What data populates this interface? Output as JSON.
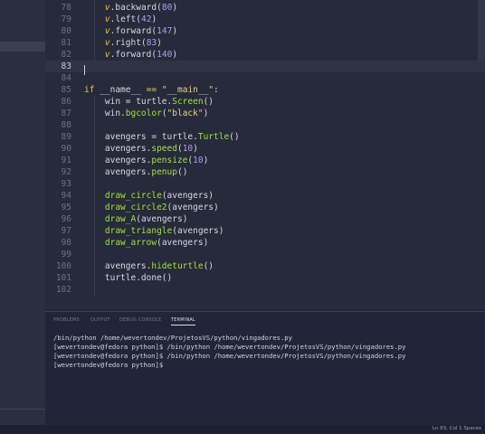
{
  "editor": {
    "lines": [
      {
        "n": "78",
        "segments": [
          {
            "t": "    ",
            "c": ""
          },
          {
            "t": "v",
            "c": "it"
          },
          {
            "t": ".",
            "c": ""
          },
          {
            "t": "backward",
            "c": ""
          },
          {
            "t": "(",
            "c": ""
          },
          {
            "t": "80",
            "c": "nu"
          },
          {
            "t": ")",
            "c": ""
          }
        ]
      },
      {
        "n": "79",
        "segments": [
          {
            "t": "    ",
            "c": ""
          },
          {
            "t": "v",
            "c": "it"
          },
          {
            "t": ".",
            "c": ""
          },
          {
            "t": "left",
            "c": ""
          },
          {
            "t": "(",
            "c": ""
          },
          {
            "t": "42",
            "c": "nu"
          },
          {
            "t": ")",
            "c": ""
          }
        ]
      },
      {
        "n": "80",
        "segments": [
          {
            "t": "    ",
            "c": ""
          },
          {
            "t": "v",
            "c": "it"
          },
          {
            "t": ".",
            "c": ""
          },
          {
            "t": "forward",
            "c": ""
          },
          {
            "t": "(",
            "c": ""
          },
          {
            "t": "147",
            "c": "nu"
          },
          {
            "t": ")",
            "c": ""
          }
        ]
      },
      {
        "n": "81",
        "segments": [
          {
            "t": "    ",
            "c": ""
          },
          {
            "t": "v",
            "c": "it"
          },
          {
            "t": ".",
            "c": ""
          },
          {
            "t": "right",
            "c": ""
          },
          {
            "t": "(",
            "c": ""
          },
          {
            "t": "83",
            "c": "nu"
          },
          {
            "t": ")",
            "c": ""
          }
        ]
      },
      {
        "n": "82",
        "segments": [
          {
            "t": "    ",
            "c": ""
          },
          {
            "t": "v",
            "c": "it"
          },
          {
            "t": ".",
            "c": ""
          },
          {
            "t": "forward",
            "c": ""
          },
          {
            "t": "(",
            "c": ""
          },
          {
            "t": "140",
            "c": "nu"
          },
          {
            "t": ")",
            "c": ""
          }
        ]
      },
      {
        "n": "83",
        "segments": [],
        "current": true
      },
      {
        "n": "84",
        "segments": []
      },
      {
        "n": "85",
        "segments": [
          {
            "t": "if",
            "c": "kw"
          },
          {
            "t": " __name__ ",
            "c": ""
          },
          {
            "t": "==",
            "c": "kw"
          },
          {
            "t": " ",
            "c": ""
          },
          {
            "t": "\"__main__\"",
            "c": "st"
          },
          {
            "t": ":",
            "c": ""
          }
        ]
      },
      {
        "n": "86",
        "segments": [
          {
            "t": "    win = turtle.",
            "c": ""
          },
          {
            "t": "Screen",
            "c": "fn"
          },
          {
            "t": "()",
            "c": ""
          }
        ]
      },
      {
        "n": "87",
        "segments": [
          {
            "t": "    win.",
            "c": ""
          },
          {
            "t": "bgcolor",
            "c": "fn"
          },
          {
            "t": "(",
            "c": ""
          },
          {
            "t": "\"black\"",
            "c": "st"
          },
          {
            "t": ")",
            "c": ""
          }
        ]
      },
      {
        "n": "88",
        "segments": []
      },
      {
        "n": "89",
        "segments": [
          {
            "t": "    avengers = turtle.",
            "c": ""
          },
          {
            "t": "Turtle",
            "c": "fn"
          },
          {
            "t": "()",
            "c": ""
          }
        ]
      },
      {
        "n": "90",
        "segments": [
          {
            "t": "    avengers.",
            "c": ""
          },
          {
            "t": "speed",
            "c": "fn"
          },
          {
            "t": "(",
            "c": ""
          },
          {
            "t": "10",
            "c": "nu"
          },
          {
            "t": ")",
            "c": ""
          }
        ]
      },
      {
        "n": "91",
        "segments": [
          {
            "t": "    avengers.",
            "c": ""
          },
          {
            "t": "pensize",
            "c": "fn"
          },
          {
            "t": "(",
            "c": ""
          },
          {
            "t": "10",
            "c": "nu"
          },
          {
            "t": ")",
            "c": ""
          }
        ]
      },
      {
        "n": "92",
        "segments": [
          {
            "t": "    avengers.",
            "c": ""
          },
          {
            "t": "penup",
            "c": "fn"
          },
          {
            "t": "()",
            "c": ""
          }
        ]
      },
      {
        "n": "93",
        "segments": []
      },
      {
        "n": "94",
        "segments": [
          {
            "t": "    ",
            "c": ""
          },
          {
            "t": "draw_circle",
            "c": "fn"
          },
          {
            "t": "(avengers)",
            "c": ""
          }
        ]
      },
      {
        "n": "95",
        "segments": [
          {
            "t": "    ",
            "c": ""
          },
          {
            "t": "draw_circle2",
            "c": "fn"
          },
          {
            "t": "(avengers)",
            "c": ""
          }
        ]
      },
      {
        "n": "96",
        "segments": [
          {
            "t": "    ",
            "c": ""
          },
          {
            "t": "draw_A",
            "c": "fn"
          },
          {
            "t": "(avengers)",
            "c": ""
          }
        ]
      },
      {
        "n": "97",
        "segments": [
          {
            "t": "    ",
            "c": ""
          },
          {
            "t": "draw_triangle",
            "c": "fn"
          },
          {
            "t": "(avengers)",
            "c": ""
          }
        ]
      },
      {
        "n": "98",
        "segments": [
          {
            "t": "    ",
            "c": ""
          },
          {
            "t": "draw_arrow",
            "c": "fn"
          },
          {
            "t": "(avengers)",
            "c": ""
          }
        ]
      },
      {
        "n": "99",
        "segments": []
      },
      {
        "n": "100",
        "segments": [
          {
            "t": "    avengers.",
            "c": ""
          },
          {
            "t": "hideturtle",
            "c": "fn"
          },
          {
            "t": "()",
            "c": ""
          }
        ]
      },
      {
        "n": "101",
        "segments": [
          {
            "t": "    turtle.done()",
            "c": ""
          }
        ]
      },
      {
        "n": "102",
        "segments": []
      }
    ]
  },
  "panel": {
    "tabs": [
      {
        "label": "PROBLEMS",
        "active": false
      },
      {
        "label": "OUTPUT",
        "active": false
      },
      {
        "label": "DEBUG CONSOLE",
        "active": false
      },
      {
        "label": "TERMINAL",
        "active": true
      }
    ],
    "terminal_lines": [
      "/bin/python /home/wevertondev/ProjetosVS/python/vingadores.py",
      "[wevertondev@fedora python]$ /bin/python /home/wevertondev/ProjetosVS/python/vingadores.py",
      "[wevertondev@fedora python]$ /bin/python /home/wevertondev/ProjetosVS/python/vingadores.py",
      "[wevertondev@fedora python]$ "
    ]
  },
  "statusbar": {
    "text": "Ln 83, Col 1   Spaces"
  },
  "colors": {
    "editor_bg": "#262a3b",
    "keyword": "#f0c848",
    "function": "#a3e23c",
    "string": "#e3d77c",
    "number": "#b09cf0"
  }
}
